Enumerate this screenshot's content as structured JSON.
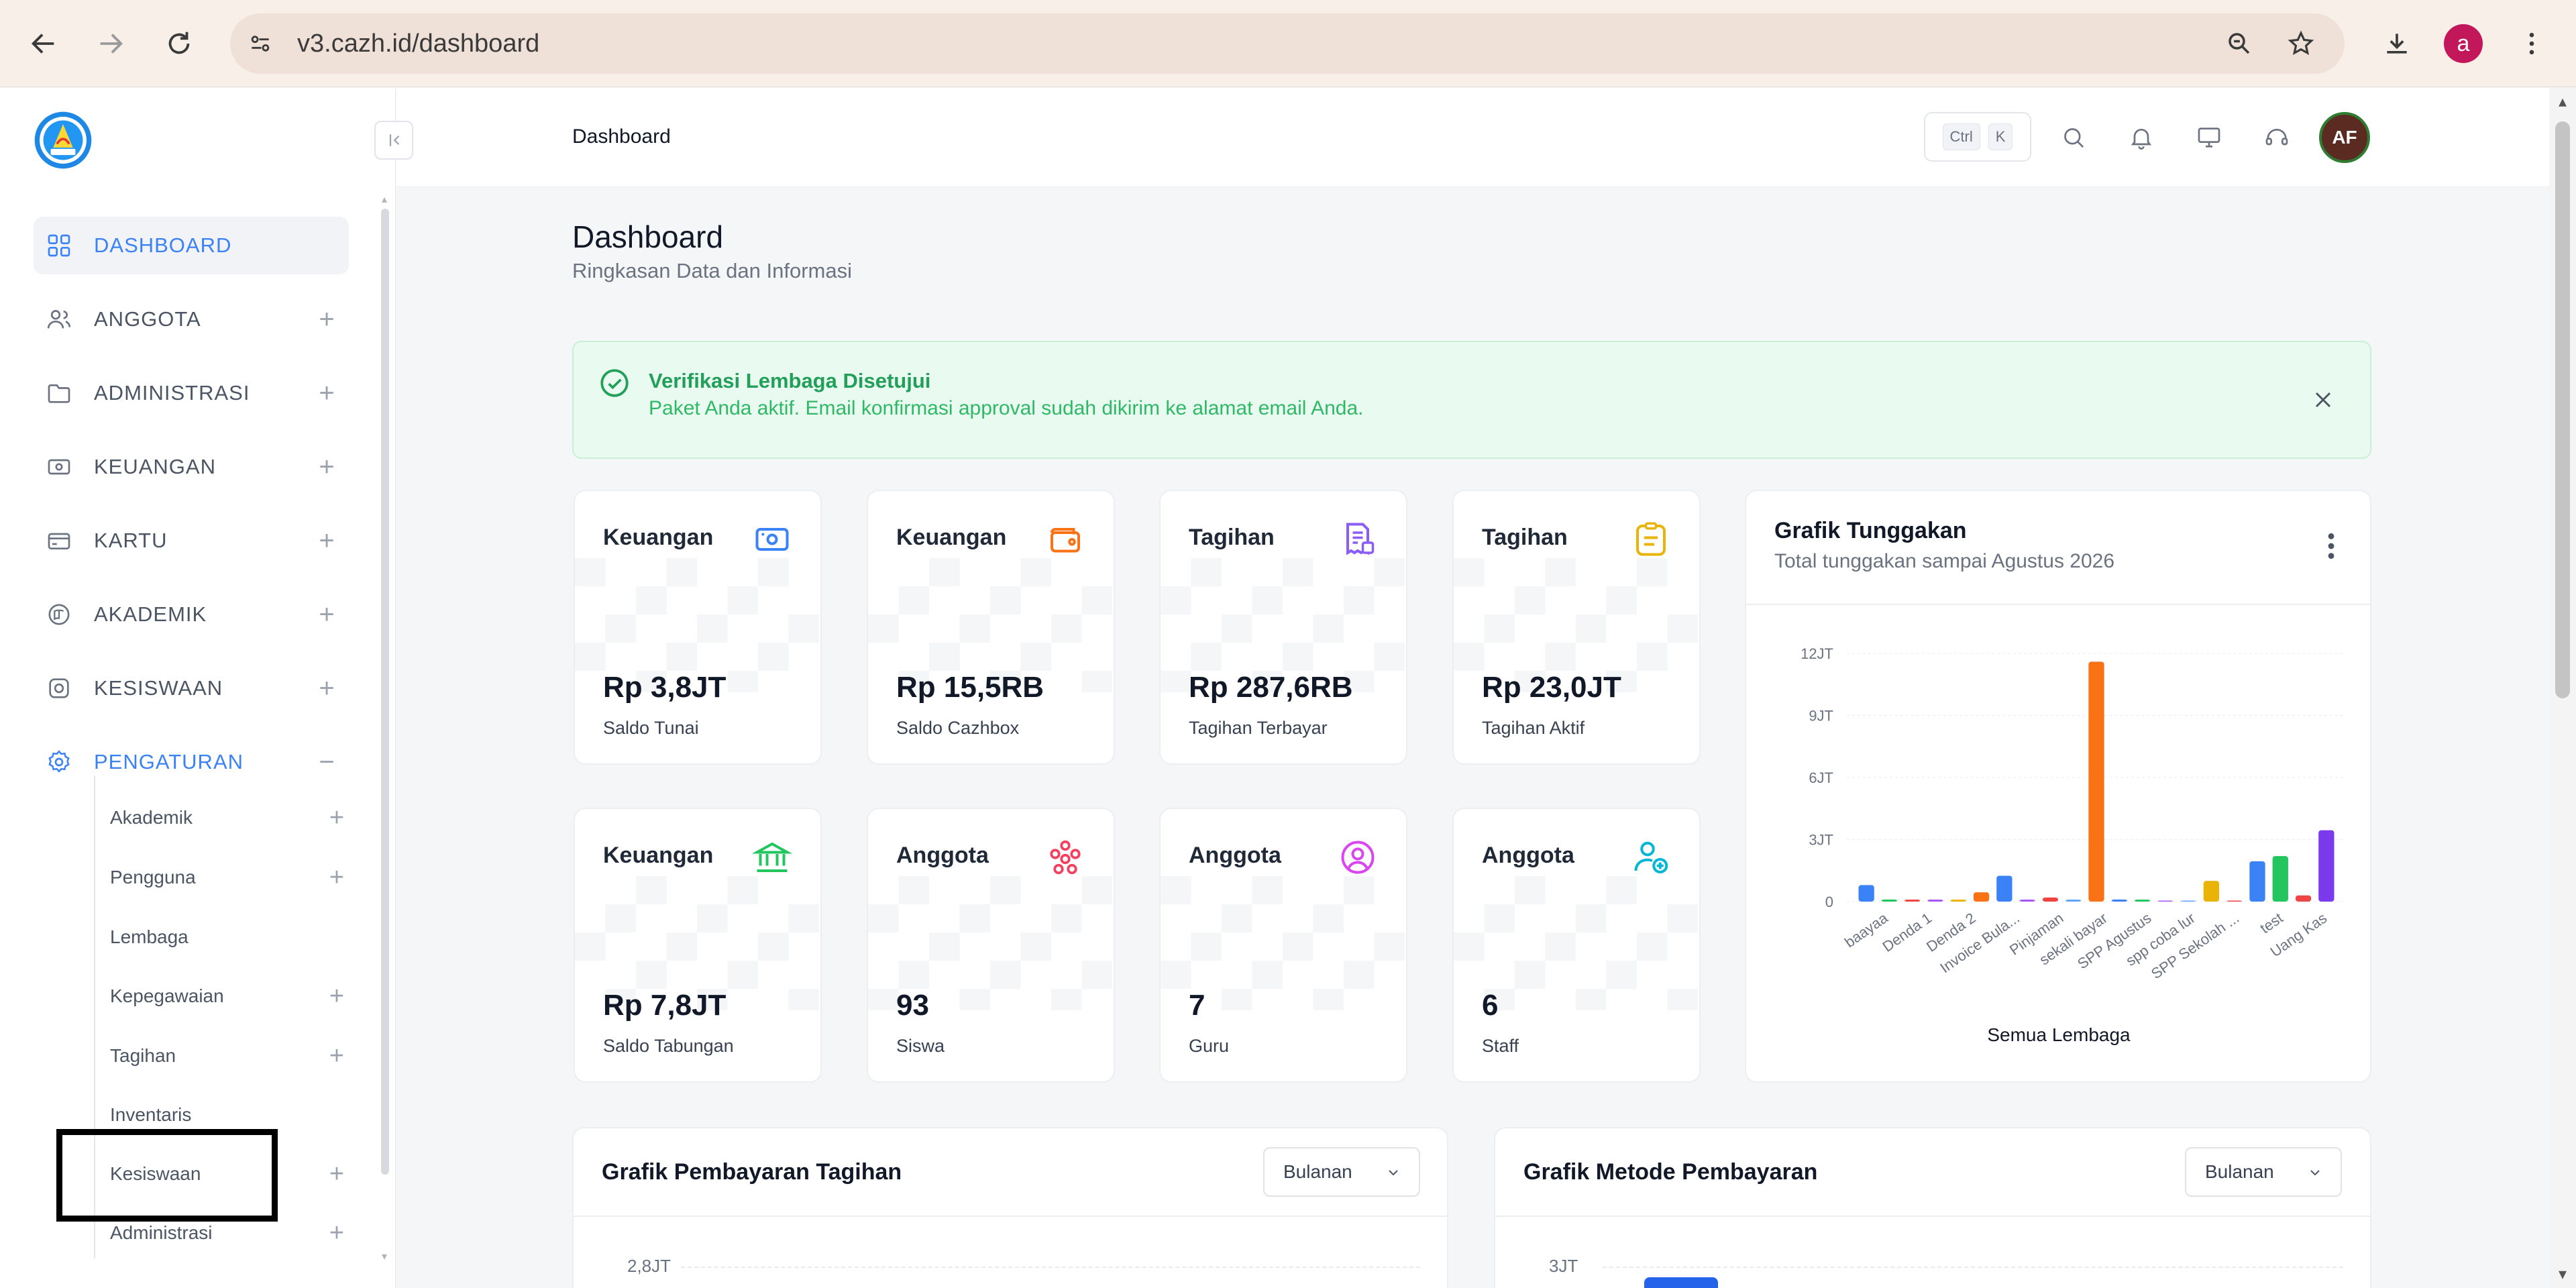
{
  "browser": {
    "url": "v3.cazh.id/dashboard",
    "profile_initial": "a"
  },
  "sidebar": {
    "items": [
      {
        "label": "DASHBOARD",
        "icon": "grid-icon",
        "active": true
      },
      {
        "label": "ANGGOTA",
        "icon": "users-icon"
      },
      {
        "label": "ADMINISTRASI",
        "icon": "folder-icon"
      },
      {
        "label": "KEUANGAN",
        "icon": "money-icon"
      },
      {
        "label": "KARTU",
        "icon": "card-icon"
      },
      {
        "label": "AKADEMIK",
        "icon": "book-icon"
      },
      {
        "label": "KESISWAAN",
        "icon": "student-icon"
      },
      {
        "label": "PENGATURAN",
        "icon": "gear-icon",
        "open": true
      }
    ],
    "submenu": [
      {
        "label": "Akademik",
        "expandable": true
      },
      {
        "label": "Pengguna",
        "expandable": true
      },
      {
        "label": "Lembaga",
        "expandable": false
      },
      {
        "label": "Kepegawaian",
        "expandable": true
      },
      {
        "label": "Tagihan",
        "expandable": true
      },
      {
        "label": "Inventaris",
        "expandable": false
      },
      {
        "label": "Kesiswaan",
        "expandable": true
      },
      {
        "label": "Administrasi",
        "expandable": true
      }
    ]
  },
  "topbar": {
    "breadcrumb": "Dashboard",
    "shortcut": [
      "Ctrl",
      "K"
    ],
    "avatar_initials": "AF"
  },
  "page": {
    "title": "Dashboard",
    "subtitle": "Ringkasan Data dan Informasi"
  },
  "alert": {
    "title": "Verifikasi Lembaga Disetujui",
    "message": "Paket Anda aktif. Email konfirmasi approval sudah dikirim ke alamat email Anda.",
    "color": "#22a05a"
  },
  "stats": [
    {
      "title": "Keuangan",
      "value": "Rp 3,8JT",
      "label": "Saldo Tunai",
      "icon": "cash-icon",
      "color": "#3b82f6"
    },
    {
      "title": "Keuangan",
      "value": "Rp 15,5RB",
      "label": "Saldo Cazhbox",
      "icon": "wallet-icon",
      "color": "#f97316"
    },
    {
      "title": "Tagihan",
      "value": "Rp 287,6RB",
      "label": "Tagihan Terbayar",
      "icon": "invoice-paid-icon",
      "color": "#8b5cf6"
    },
    {
      "title": "Tagihan",
      "value": "Rp 23,0JT",
      "label": "Tagihan Aktif",
      "icon": "invoice-active-icon",
      "color": "#eab308"
    },
    {
      "title": "Keuangan",
      "value": "Rp 7,8JT",
      "label": "Saldo Tabungan",
      "icon": "bank-icon",
      "color": "#22c55e"
    },
    {
      "title": "Anggota",
      "value": "93",
      "label": "Siswa",
      "icon": "group-icon",
      "color": "#f43f5e"
    },
    {
      "title": "Anggota",
      "value": "7",
      "label": "Guru",
      "icon": "user-circle-icon",
      "color": "#d946ef"
    },
    {
      "title": "Anggota",
      "value": "6",
      "label": "Staff",
      "icon": "user-add-icon",
      "color": "#06b6d4"
    }
  ],
  "tunggakan": {
    "title": "Grafik Tunggakan",
    "subtitle": "Total tunggakan sampai Agustus 2026"
  },
  "chart_data": {
    "type": "bar",
    "title": "Grafik Tunggakan",
    "xlabel": "Semua Lembaga",
    "ylabel": "",
    "ylim": [
      0,
      12000000
    ],
    "yticks": [
      "0",
      "3JT",
      "6JT",
      "9JT",
      "12JT"
    ],
    "categories": [
      "baayaa",
      "Denda 1",
      "Denda 2",
      "Invoice Bula...",
      "Pinjaman",
      "sekali bayar",
      "SPP Agustus",
      "spp coba lur",
      "SPP Sekolah ...",
      "test",
      "Uang Kas"
    ],
    "shown_tick_labels": [
      "baayaa",
      "Denda 1",
      "Denda 2",
      "Invoice Bula...",
      "Pinjaman",
      "sekali bayar",
      "SPP Agustus",
      "spp coba lur",
      "SPP Sekolah ...",
      "test",
      "Uang Kas"
    ],
    "bars": [
      {
        "value": 800000,
        "color": "#3b82f6"
      },
      {
        "value": 100000,
        "color": "#22c55e"
      },
      {
        "value": 60000,
        "color": "#ef4444"
      },
      {
        "value": 40000,
        "color": "#a855f7"
      },
      {
        "value": 30000,
        "color": "#eab308"
      },
      {
        "value": 450000,
        "color": "#f97316"
      },
      {
        "value": 1250000,
        "color": "#3b82f6"
      },
      {
        "value": 30000,
        "color": "#a855f7"
      },
      {
        "value": 200000,
        "color": "#ef4444"
      },
      {
        "value": 40000,
        "color": "#60a5fa"
      },
      {
        "value": 11600000,
        "color": "#f97316"
      },
      {
        "value": 100000,
        "color": "#3b82f6"
      },
      {
        "value": 80000,
        "color": "#22c55e"
      },
      {
        "value": 0,
        "color": "#a855f7"
      },
      {
        "value": 0,
        "color": "#60a5fa"
      },
      {
        "value": 1000000,
        "color": "#eab308"
      },
      {
        "value": 0,
        "color": "#ef4444"
      },
      {
        "value": 1950000,
        "color": "#3b82f6"
      },
      {
        "value": 2200000,
        "color": "#22c55e"
      },
      {
        "value": 300000,
        "color": "#ef4444"
      },
      {
        "value": 3450000,
        "color": "#7c3aed"
      }
    ]
  },
  "bottom_charts": [
    {
      "title": "Grafik Pembayaran Tagihan",
      "select": "Bulanan",
      "tick": "2,8JT"
    },
    {
      "title": "Grafik Metode Pembayaran",
      "select": "Bulanan",
      "tick": "3JT"
    }
  ]
}
